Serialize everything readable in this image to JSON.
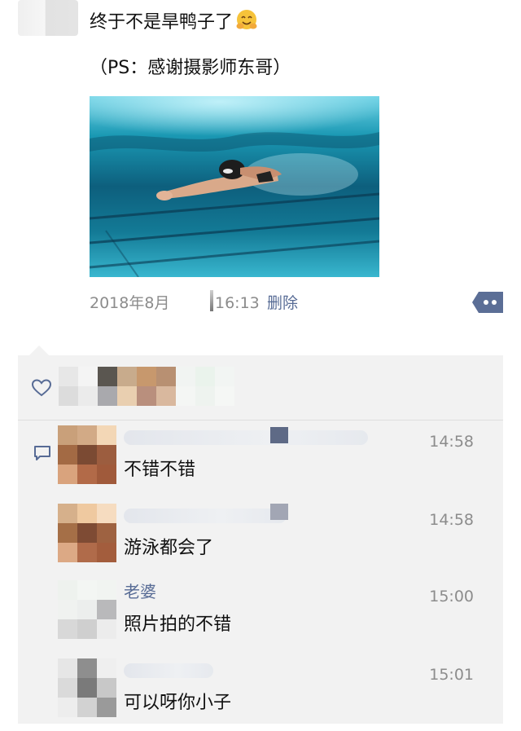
{
  "post": {
    "text": "终于不是旱鸭子了",
    "ps": "（PS：感谢摄影师东哥）",
    "date": "2018年8月",
    "time": "16:13",
    "delete_label": "删除"
  },
  "comments": [
    {
      "name": "",
      "time": "14:58",
      "text": "不错不错"
    },
    {
      "name": "",
      "time": "14:58",
      "text": "游泳都会了"
    },
    {
      "name": "老婆",
      "time": "15:00",
      "text": "照片拍的不错"
    },
    {
      "name": "",
      "time": "15:01",
      "text": "可以呀你小子"
    }
  ],
  "colors": {
    "link": "#576b95",
    "meta": "#8c8c8c",
    "panel": "#f2f2f2"
  },
  "icons": {
    "like": "heart-icon",
    "comment": "comment-icon",
    "more": "more-dots-icon",
    "emoji": "hugging-face-emoji-icon"
  }
}
